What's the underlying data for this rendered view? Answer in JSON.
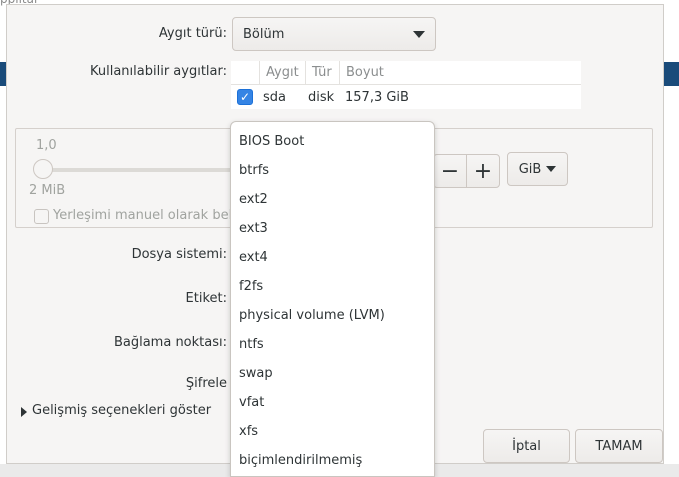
{
  "backdrop": {
    "title_fragment": "pplitar"
  },
  "form": {
    "device_type_label": "Aygıt türü:",
    "device_type_value": "Bölüm",
    "available_devices_label": "Kullanılabilir aygıtlar:",
    "filesystem_label": "Dosya sistemi:",
    "tag_label": "Etiket:",
    "mount_point_label": "Bağlama noktası:",
    "encryption_label": "Şifrele"
  },
  "device_table": {
    "columns": [
      "Aygıt",
      "Tür",
      "Boyut"
    ],
    "rows": [
      {
        "checked": true,
        "device": "sda",
        "type": "disk",
        "size": "157,3 GiB"
      }
    ]
  },
  "size": {
    "scale_top_value": "1,0",
    "scale_min_value": "2 MiB",
    "unit": "GiB",
    "minus_label": "−",
    "plus_label": "+"
  },
  "manual_placement_label": "Yerleşimi manuel olarak belirt",
  "advanced_toggle_label": "Gelişmiş seçenekleri göster",
  "buttons": {
    "cancel": "İptal",
    "ok": "TAMAM"
  },
  "filesystem_menu": {
    "items": [
      "BIOS Boot",
      "btrfs",
      "ext2",
      "ext3",
      "ext4",
      "f2fs",
      "physical volume (LVM)",
      "ntfs",
      "swap",
      "vfat",
      "xfs",
      "biçimlendirilmemiş"
    ]
  }
}
